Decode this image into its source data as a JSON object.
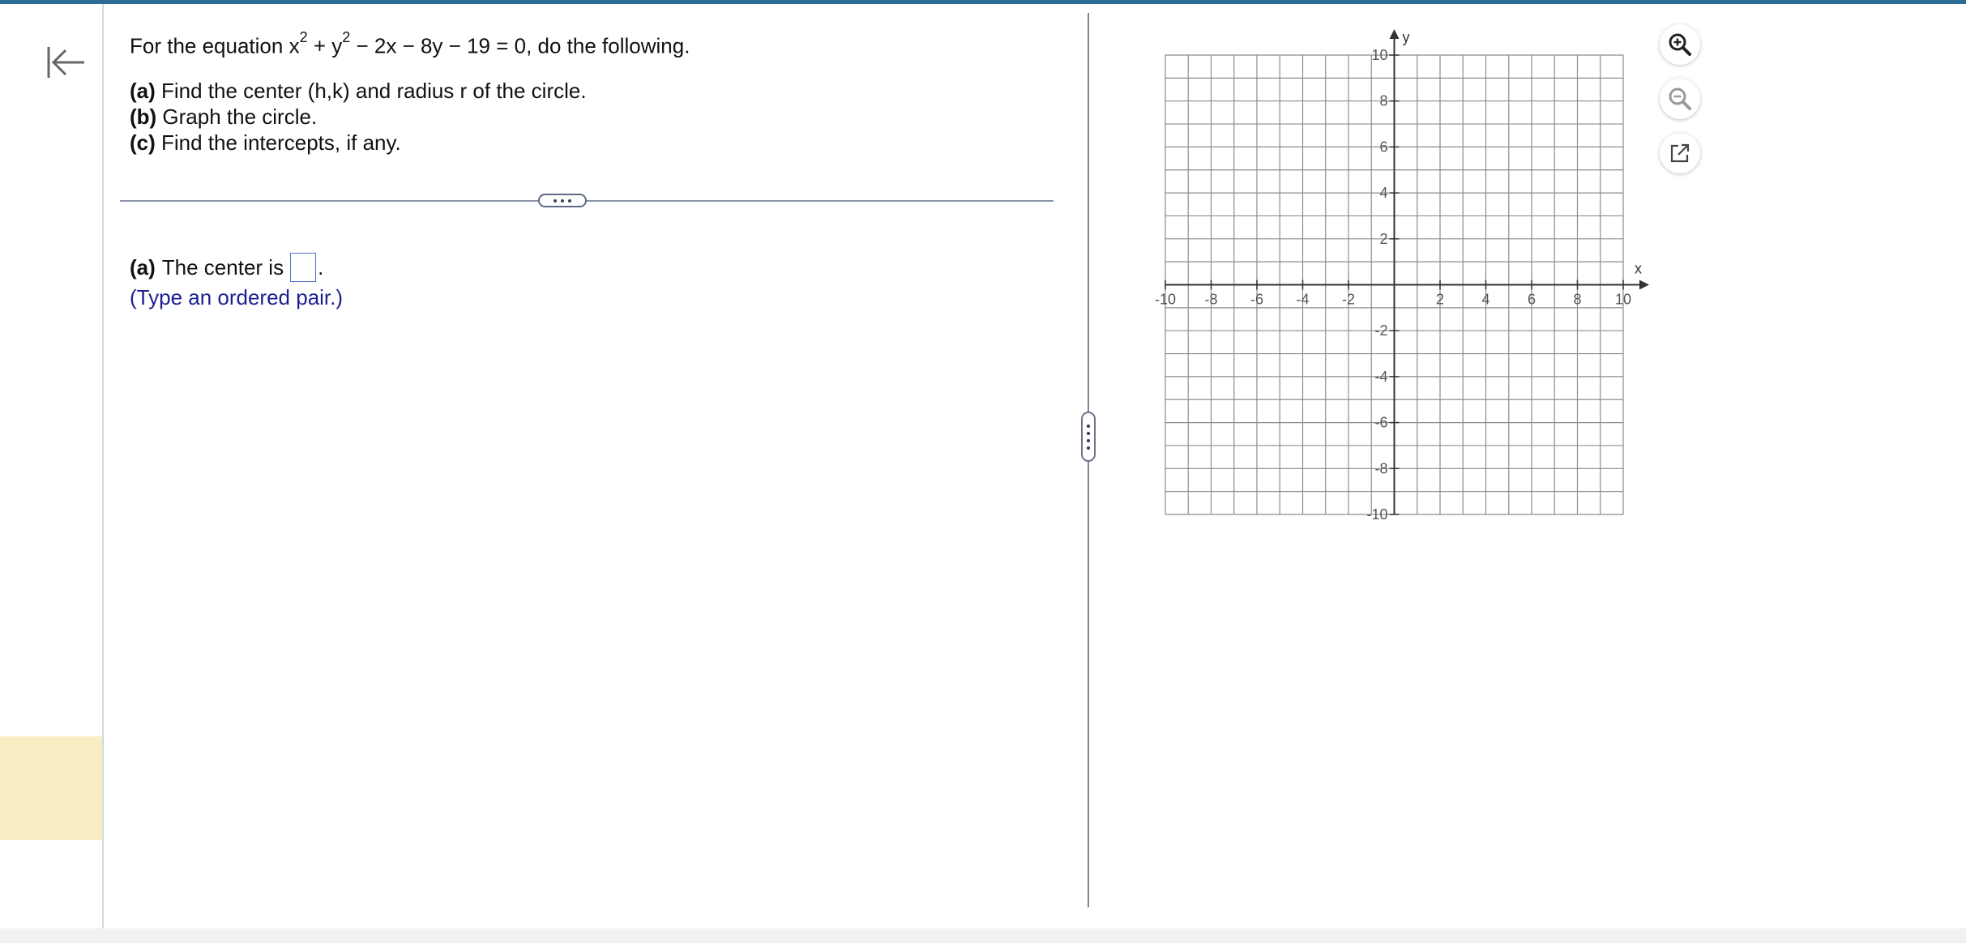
{
  "question": {
    "prefix": "For the equation x",
    "exp1": "2",
    "mid": " + y",
    "exp2": "2",
    "suffix": " − 2x − 8y − 19 = 0, do the following."
  },
  "parts": [
    {
      "label": "(a)",
      "text": " Find the center (h,k) and radius r of  the circle."
    },
    {
      "label": "(b)",
      "text": " Graph the circle."
    },
    {
      "label": "(c)",
      "text": " Find the intercepts, if any."
    }
  ],
  "answer": {
    "label": "(a)",
    "text": "The center is",
    "value": "",
    "after": ".",
    "hint": "(Type an ordered pair.)"
  },
  "graph": {
    "x_label": "x",
    "y_label": "y",
    "x_range": [
      -10,
      10
    ],
    "y_range": [
      -10,
      10
    ],
    "grid_step": 1,
    "x_ticks": [
      "-10",
      "-8",
      "-6",
      "-4",
      "-2",
      "2",
      "4",
      "6",
      "8",
      "10"
    ],
    "y_ticks": [
      "10",
      "8",
      "6",
      "4",
      "2",
      "-2",
      "-4",
      "-6",
      "-8",
      "-10"
    ]
  },
  "tools": {
    "zoom_in_icon": "zoom-in-icon",
    "zoom_out_icon": "zoom-out-icon",
    "popout_icon": "external-link-icon"
  },
  "colors": {
    "accent": "#2e6b93",
    "answer_box": "#4e74c9",
    "hint_text": "#1b1f8f",
    "sidebar_highlight": "#f9edc4"
  }
}
